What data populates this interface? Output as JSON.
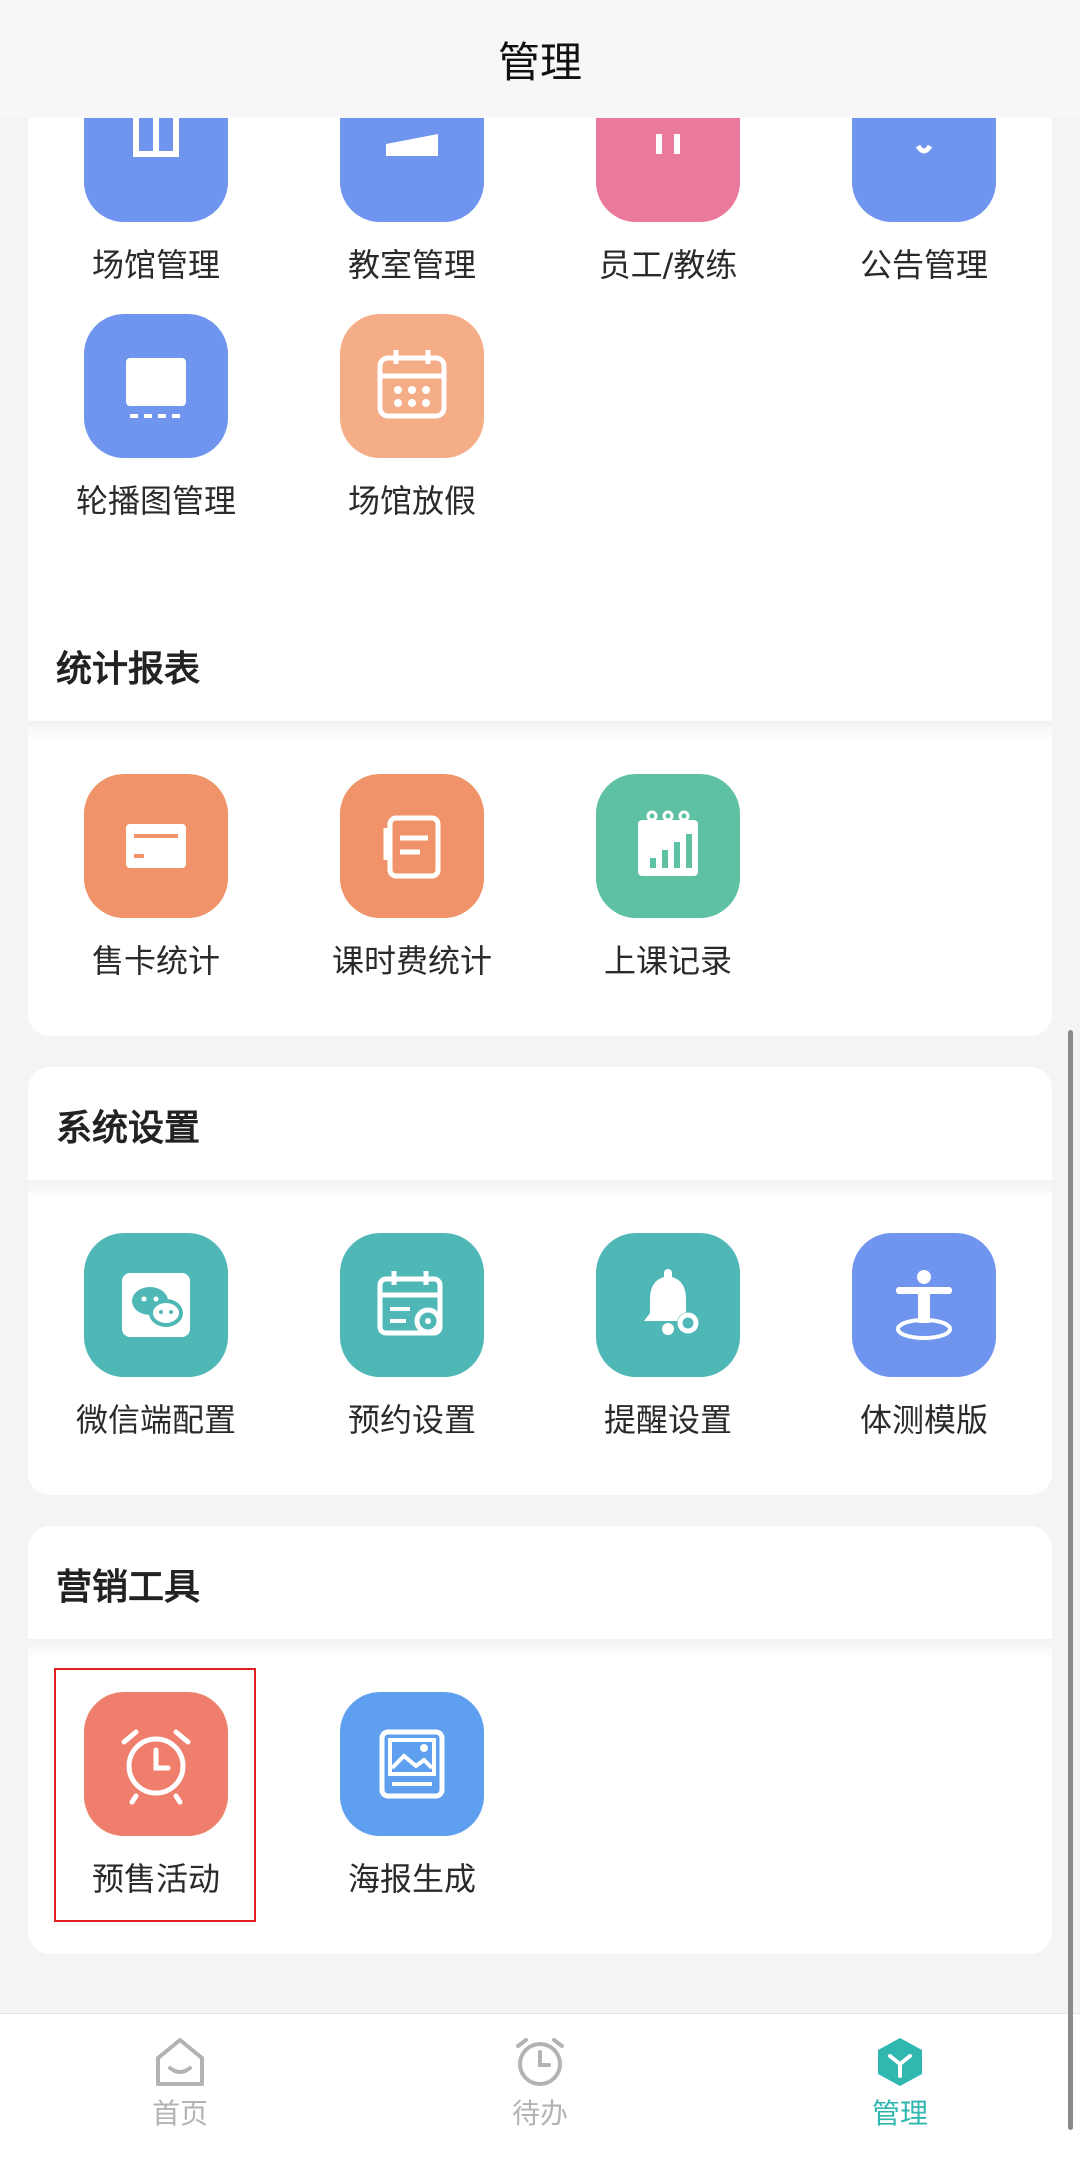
{
  "header": {
    "title": "管理"
  },
  "sections": [
    {
      "title": "",
      "items": [
        {
          "label": "场馆管理",
          "color": "#6f95ef",
          "icon": "venue-icon"
        },
        {
          "label": "教室管理",
          "color": "#6f95ef",
          "icon": "classroom-icon"
        },
        {
          "label": "员工/教练",
          "color": "#e97a9c",
          "icon": "staff-icon"
        },
        {
          "label": "公告管理",
          "color": "#6f95ef",
          "icon": "announcement-icon"
        },
        {
          "label": "轮播图管理",
          "color": "#6f95ef",
          "icon": "carousel-icon"
        },
        {
          "label": "场馆放假",
          "color": "#f4ad86",
          "icon": "calendar-icon"
        }
      ]
    },
    {
      "title": "统计报表",
      "items": [
        {
          "label": "售卡统计",
          "color": "#f0936a",
          "icon": "card-icon"
        },
        {
          "label": "课时费统计",
          "color": "#f0936a",
          "icon": "document-icon"
        },
        {
          "label": "上课记录",
          "color": "#5fc1a4",
          "icon": "bar-chart-icon"
        }
      ]
    },
    {
      "title": "系统设置",
      "items": [
        {
          "label": "微信端配置",
          "color": "#4fb8b6",
          "icon": "wechat-icon"
        },
        {
          "label": "预约设置",
          "color": "#4fb8b6",
          "icon": "calendar-gear-icon"
        },
        {
          "label": "提醒设置",
          "color": "#4fb8b6",
          "icon": "bell-gear-icon"
        },
        {
          "label": "体测模版",
          "color": "#6f95ef",
          "icon": "body-test-icon"
        }
      ]
    },
    {
      "title": "营销工具",
      "items": [
        {
          "label": "预售活动",
          "color": "#ef7f6c",
          "icon": "alarm-clock-icon"
        },
        {
          "label": "海报生成",
          "color": "#5f9ff0",
          "icon": "poster-icon"
        }
      ]
    }
  ],
  "tabbar": {
    "items": [
      {
        "label": "首页",
        "icon": "home-icon"
      },
      {
        "label": "待办",
        "icon": "clock-icon"
      },
      {
        "label": "管理",
        "icon": "cube-icon",
        "active": true
      }
    ],
    "active_color": "#2fb7b0",
    "inactive_color": "#b3b3b3"
  }
}
